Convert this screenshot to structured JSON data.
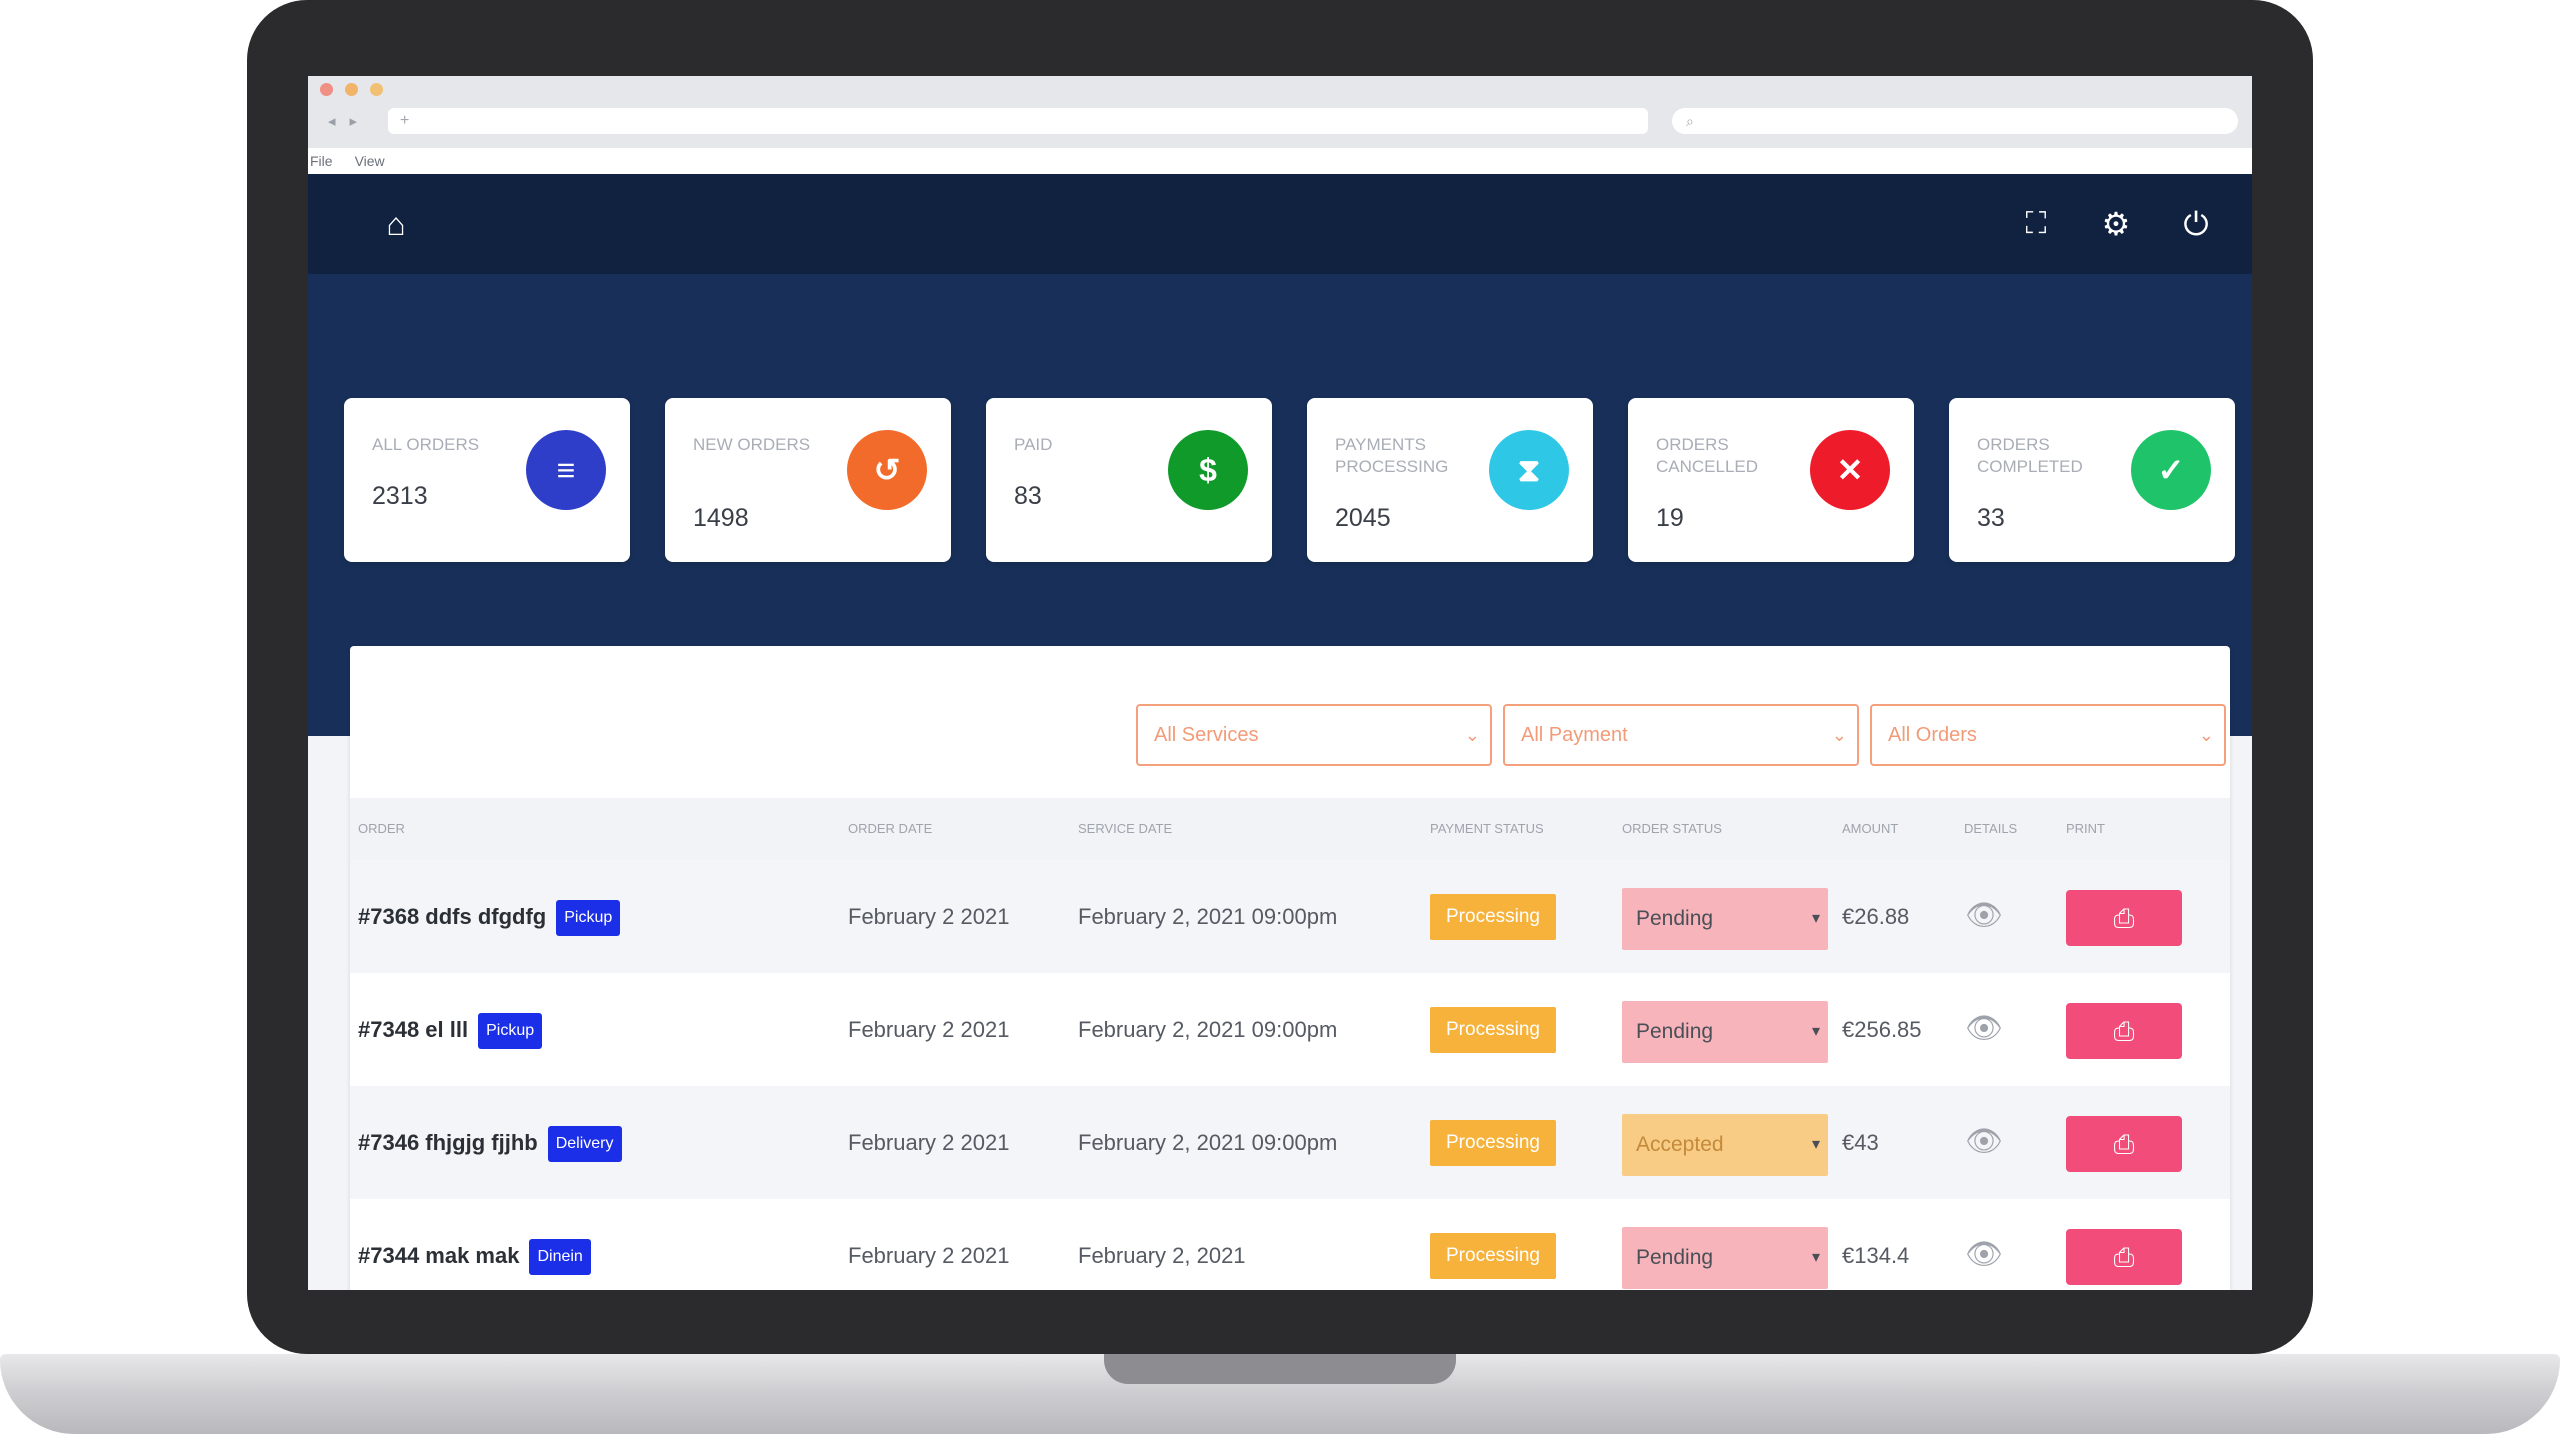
{
  "browser": {
    "url_placeholder": "+",
    "search_placeholder": "⌕",
    "back": "◂",
    "forward": "▸",
    "menu": [
      "File",
      "View"
    ]
  },
  "appbar": {
    "home_icon": "home-icon",
    "icons": [
      "fullscreen-icon",
      "gear-icon",
      "power-icon"
    ]
  },
  "stats": [
    {
      "label": "ALL ORDERS",
      "value": "2313",
      "icon": "list-icon",
      "glyph": "≡",
      "color": "#2f3ec9"
    },
    {
      "label": "NEW ORDERS",
      "value": "1498",
      "icon": "history-icon",
      "glyph": "↺",
      "color": "#f26b2b"
    },
    {
      "label": "PAID",
      "value": "83",
      "icon": "dollar-icon",
      "glyph": "$",
      "color": "#0f9a2a"
    },
    {
      "label": "PAYMENTS PROCESSING",
      "value": "2045",
      "icon": "hourglass-icon",
      "glyph": "⧗",
      "color": "#2ec8e6"
    },
    {
      "label": "ORDERS CANCELLED",
      "value": "19",
      "icon": "close-icon",
      "glyph": "✕",
      "color": "#ee1c2a"
    },
    {
      "label": "ORDERS COMPLETED",
      "value": "33",
      "icon": "check-icon",
      "glyph": "✓",
      "color": "#1fc46a"
    }
  ],
  "filters": [
    {
      "label": "All Services"
    },
    {
      "label": "All Payment"
    },
    {
      "label": "All Orders"
    }
  ],
  "table": {
    "headers": [
      "ORDER",
      "ORDER DATE",
      "SERVICE DATE",
      "PAYMENT STATUS",
      "ORDER STATUS",
      "AMOUNT",
      "DETAILS",
      "PRINT"
    ],
    "rows": [
      {
        "order": "#7368 ddfs dfgdfg",
        "tag": "Pickup",
        "order_date": "February 2 2021",
        "service_date": "February 2, 2021 09:00pm",
        "payment": "Processing",
        "status": "Pending",
        "amount": "€26.88"
      },
      {
        "order": "#7348 el lll",
        "tag": "Pickup",
        "order_date": "February 2 2021",
        "service_date": "February 2, 2021 09:00pm",
        "payment": "Processing",
        "status": "Pending",
        "amount": "€256.85"
      },
      {
        "order": "#7346 fhjgjg fjjhb",
        "tag": "Delivery",
        "order_date": "February 2 2021",
        "service_date": "February 2, 2021 09:00pm",
        "payment": "Processing",
        "status": "Accepted",
        "amount": "€43"
      },
      {
        "order": "#7344 mak mak",
        "tag": "Dinein",
        "order_date": "February 2 2021",
        "service_date": "February 2, 2021",
        "payment": "Processing",
        "status": "Pending",
        "amount": "€134.4"
      }
    ]
  },
  "colors": {
    "appbar": "#112140",
    "hero": "#183059",
    "accent_orange": "#f4a07d",
    "print_button": "#f24d7a",
    "payment_badge": "#f6b23a",
    "service_tag": "#1c2fe8"
  }
}
